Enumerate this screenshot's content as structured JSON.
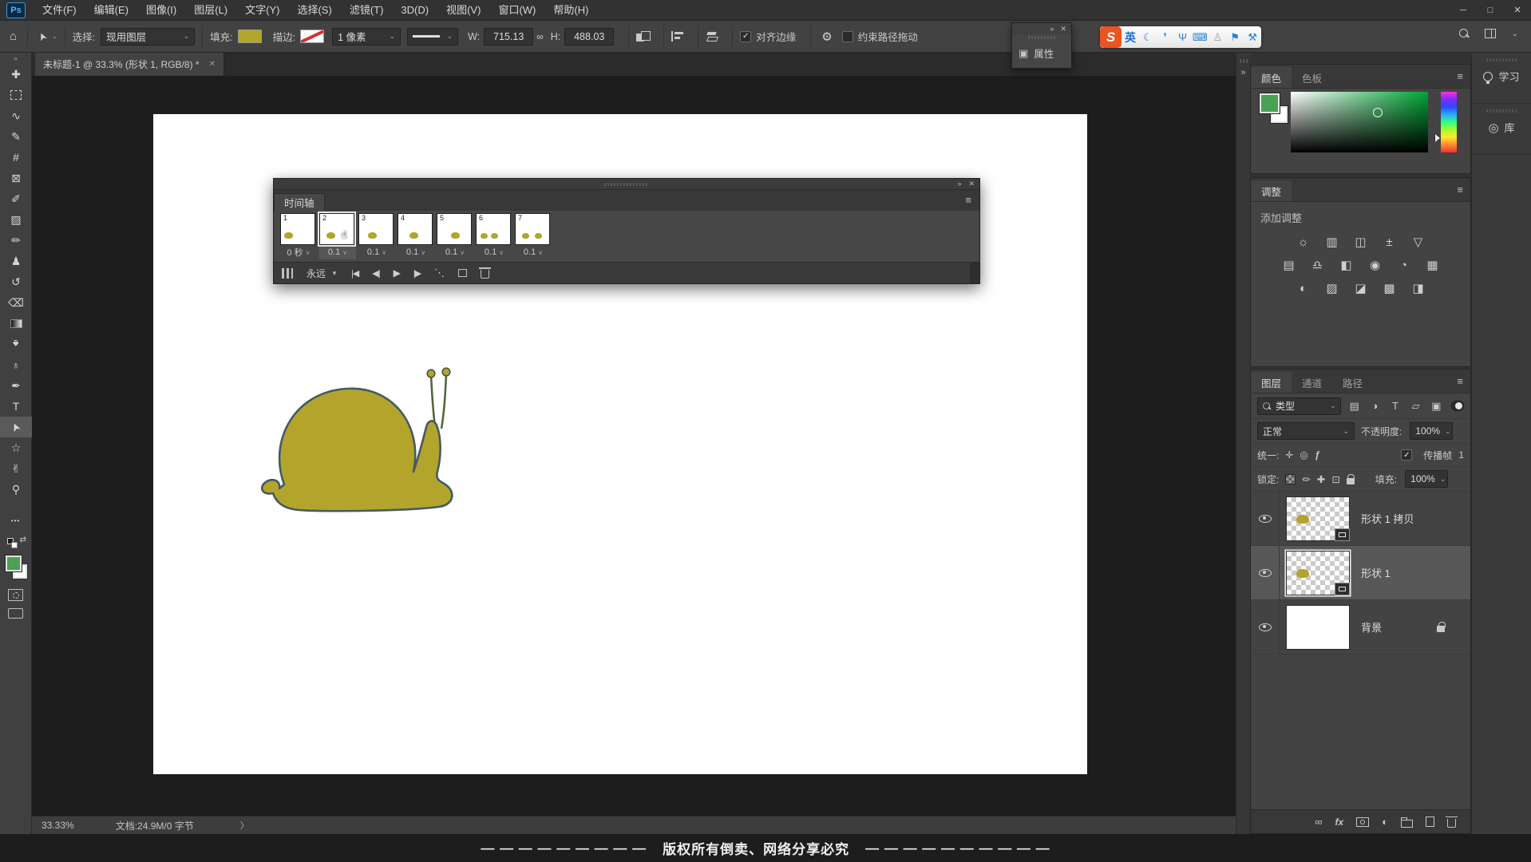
{
  "ui": {
    "menu": "≡",
    "chev": "⌄",
    "vee": "∨",
    "tri": "▼",
    "close": "✕",
    "collapse_r": "»",
    "collapse_l": "«",
    "check": "✓",
    "ellipsis": "•••",
    "swap_arrow": "⇄"
  },
  "window": {
    "minimize": "─",
    "maximize": "□",
    "close": "✕"
  },
  "menu_bar": {
    "logo": "Ps",
    "items": [
      "文件(F)",
      "编辑(E)",
      "图像(I)",
      "图层(L)",
      "文字(Y)",
      "选择(S)",
      "滤镜(T)",
      "3D(D)",
      "视图(V)",
      "窗口(W)",
      "帮助(H)"
    ]
  },
  "options": {
    "home_icon": "⌂",
    "tool_arrow": "➤",
    "select_label": "选择:",
    "select_value": "现用图层",
    "fill_label": "填充:",
    "stroke_label": "描边:",
    "stroke_width": "1 像素",
    "w_label": "W:",
    "w_value": "715.13",
    "link_icon": "∞",
    "h_label": "H:",
    "h_value": "488.03",
    "align_edges": "对齐边缘",
    "gear_icon": "⚙",
    "constrain": "约束路径拖动"
  },
  "sogou": {
    "logo": "S",
    "lang": "英",
    "moon": "☾",
    "punct": "❜",
    "mic": "Ψ",
    "keyboard": "⌨",
    "account": "♙",
    "skin": "⚑",
    "toolbox": "⚒"
  },
  "props_float": {
    "icon": "▣",
    "title": "属性"
  },
  "doc_tab": {
    "title": "未标题-1 @ 33.3% (形状 1, RGB/8) *"
  },
  "toolbar": {
    "tools": [
      {
        "name": "move",
        "glyph": "✚"
      },
      {
        "name": "rect-marquee",
        "glyph": ""
      },
      {
        "name": "lasso",
        "glyph": "∿"
      },
      {
        "name": "quick-selection",
        "glyph": "✎"
      },
      {
        "name": "crop",
        "glyph": "#"
      },
      {
        "name": "frame",
        "glyph": "⊠"
      },
      {
        "name": "eyedropper",
        "glyph": "✐"
      },
      {
        "name": "spot-healing",
        "glyph": "▨"
      },
      {
        "name": "brush",
        "glyph": "✏"
      },
      {
        "name": "clone-stamp",
        "glyph": "♟"
      },
      {
        "name": "history-brush",
        "glyph": "↺"
      },
      {
        "name": "eraser",
        "glyph": "⌫"
      },
      {
        "name": "gradient",
        "glyph": ""
      },
      {
        "name": "blur",
        "glyph": "♠"
      },
      {
        "name": "dodge",
        "glyph": "♁"
      },
      {
        "name": "pen",
        "glyph": "✒"
      },
      {
        "name": "type",
        "glyph": "T"
      },
      {
        "name": "path-selection",
        "glyph": "➤"
      },
      {
        "name": "custom-shape",
        "glyph": "☆"
      },
      {
        "name": "hand",
        "glyph": "✌"
      },
      {
        "name": "zoom",
        "glyph": "⚲"
      }
    ]
  },
  "timeline": {
    "title": "时间轴",
    "frames": [
      {
        "num": "1",
        "dur": "0 秒"
      },
      {
        "num": "2",
        "dur": "0.1"
      },
      {
        "num": "3",
        "dur": "0.1"
      },
      {
        "num": "4",
        "dur": "0.1"
      },
      {
        "num": "5",
        "dur": "0.1"
      },
      {
        "num": "6",
        "dur": "0.1"
      },
      {
        "num": "7",
        "dur": "0.1"
      }
    ],
    "loop": "永远",
    "first": "|◀",
    "prev": "◀|",
    "play": "▶",
    "next": "|▶",
    "tween": "⋱",
    "cursor": "☝"
  },
  "dock": {
    "color": {
      "tab_color": "颜色",
      "tab_swatches": "色板"
    },
    "adjust": {
      "title": "调整",
      "hint": "添加调整",
      "row1": [
        "☼",
        "▥",
        "◫",
        "±",
        "▽"
      ],
      "row2": [
        "▤",
        "♎",
        "◧",
        "◉",
        "◔",
        "▦"
      ],
      "row3": [
        "◐",
        "▨",
        "◪",
        "▩",
        "◨"
      ]
    },
    "layers": {
      "tab_layers": "图层",
      "tab_channels": "通道",
      "tab_paths": "路径",
      "filter_label": "类型",
      "ficons": [
        "▤",
        "◑",
        "T",
        "▱",
        "▣"
      ],
      "blend": "正常",
      "opacity_label": "不透明度:",
      "opacity": "100%",
      "unify_label": "统一:",
      "u1": "✛",
      "u2": "◎",
      "u3": "ƒ",
      "propagate": "传播帧",
      "propagate_num": "1",
      "lock_label": "锁定:",
      "lk_brush": "✏",
      "lk_move": "✚",
      "lk_board": "⊡",
      "fill_label": "填充:",
      "fill": "100%",
      "rows": [
        {
          "name": "形状 1 拷贝"
        },
        {
          "name": "形状 1"
        },
        {
          "name": "背景"
        }
      ],
      "link_icon": "∞",
      "fx": "fx",
      "adj_icon": "◐"
    },
    "side_learn": "学习",
    "side_library": "库"
  },
  "status": {
    "zoom": "33.33%",
    "doc": "文档:24.9M/0 字节",
    "chev": "〉"
  },
  "footer": {
    "left": "— — — — — — — — —",
    "text": "版权所有倒卖、网络分享必究",
    "right": "— — — — — — — — — —"
  },
  "colors": {
    "olive_shape": "#b3a42c",
    "foreground_green": "#4aa154",
    "ps_accent_blue": "#31a8ff",
    "sogou_orange": "#e9541f"
  }
}
